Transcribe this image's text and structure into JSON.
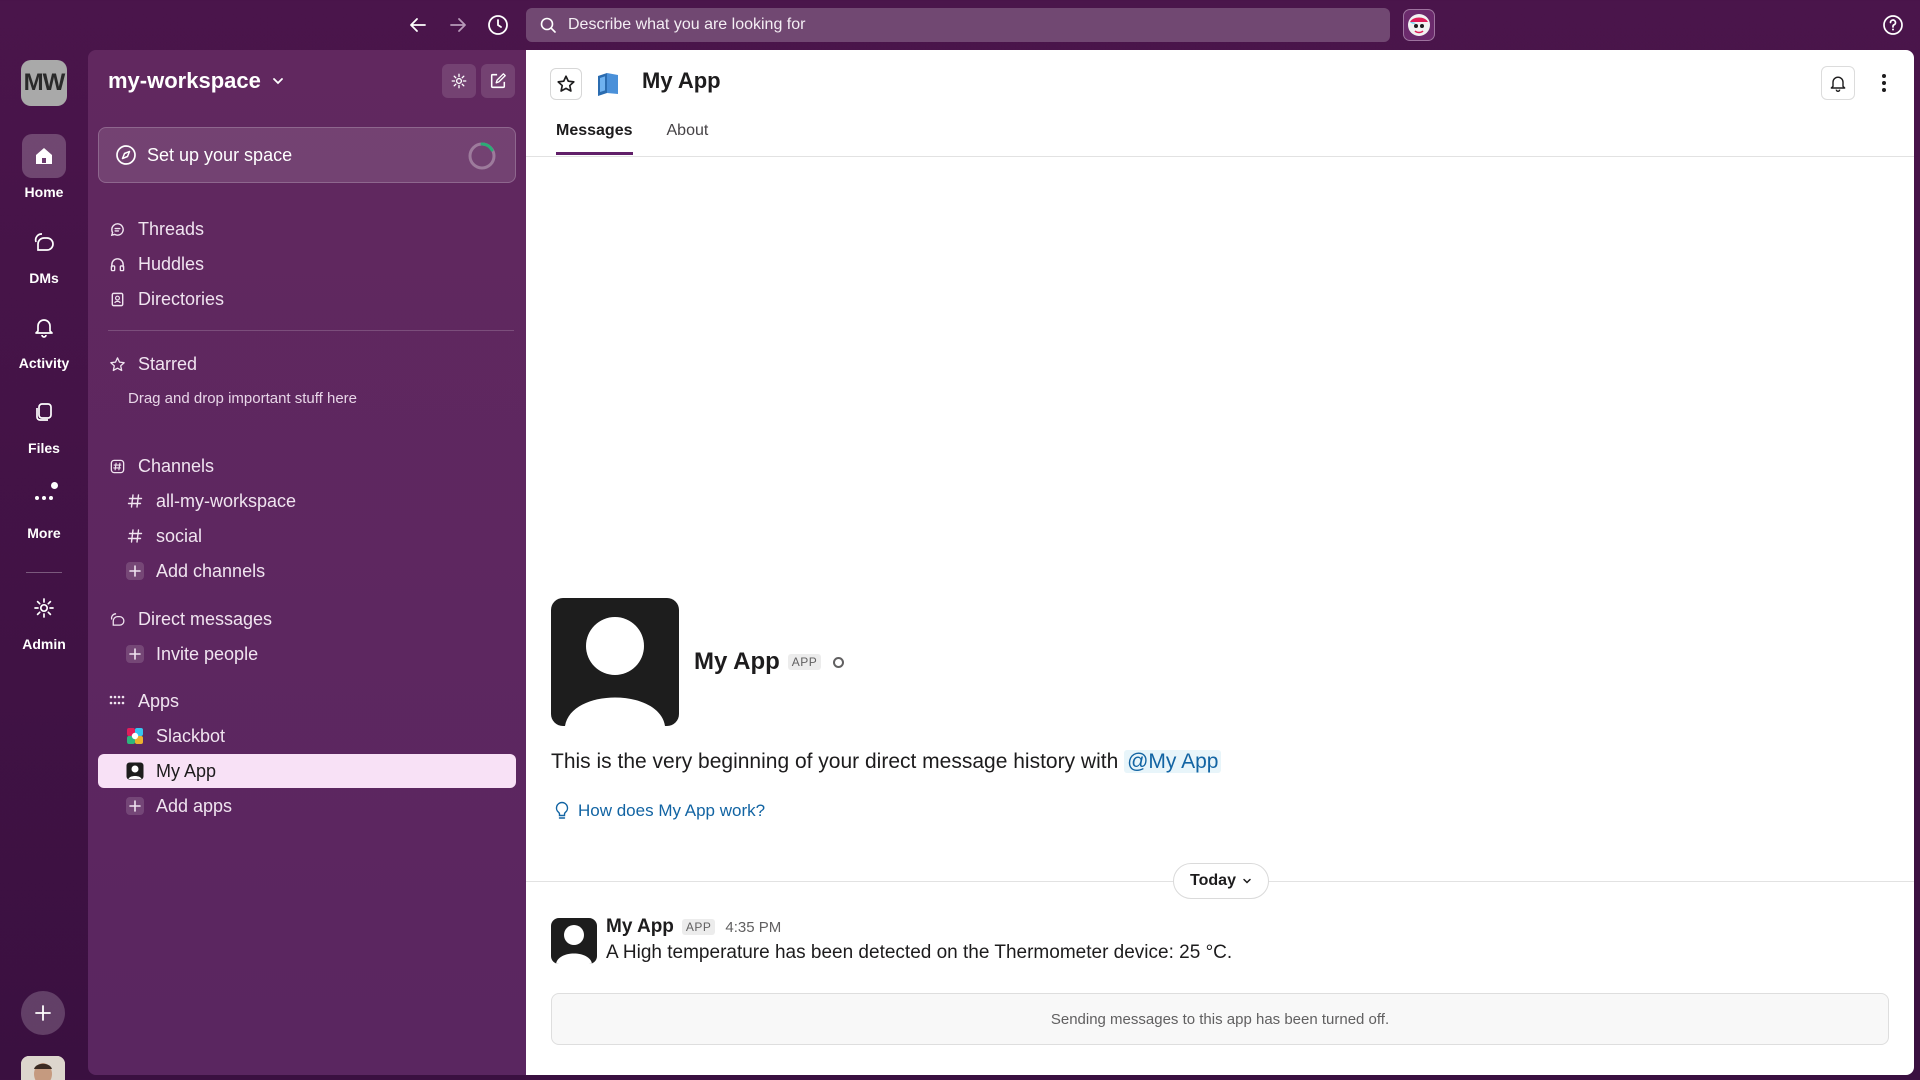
{
  "search": {
    "placeholder": "Describe what you are looking for"
  },
  "rail": {
    "workspace_initials": "MW",
    "items": [
      {
        "label": "Home"
      },
      {
        "label": "DMs"
      },
      {
        "label": "Activity"
      },
      {
        "label": "Files"
      },
      {
        "label": "More"
      },
      {
        "label": "Admin"
      }
    ]
  },
  "sidebar": {
    "workspace_name": "my-workspace",
    "setup_label": "Set up your space",
    "nav": [
      "Threads",
      "Huddles",
      "Directories"
    ],
    "starred": {
      "label": "Starred",
      "hint": "Drag and drop important stuff here"
    },
    "channels": {
      "label": "Channels",
      "items": [
        "all-my-workspace",
        "social"
      ],
      "add": "Add channels"
    },
    "dms": {
      "label": "Direct messages",
      "invite": "Invite people"
    },
    "apps": {
      "label": "Apps",
      "items": [
        "Slackbot",
        "My App"
      ],
      "add": "Add apps",
      "active": "My App"
    }
  },
  "main": {
    "title": "My App",
    "tabs": [
      {
        "label": "Messages",
        "active": true
      },
      {
        "label": "About",
        "active": false
      }
    ],
    "intro": {
      "name": "My App",
      "badge": "APP",
      "text": "This is the very beginning of your direct message history with",
      "mention": "@My App",
      "how_link": "How does My App work?"
    },
    "day_divider": "Today",
    "message": {
      "sender": "My App",
      "badge": "APP",
      "time": "4:35 PM",
      "text": "A High temperature has been detected on the Thermometer device: 25 °C."
    },
    "disabled_notice": "Sending messages to this app has been turned off."
  },
  "colors": {
    "aubergine": "#4a154b",
    "sidebar": "#5f2b62",
    "link": "#1264a3",
    "active_item": "#f8e1f6",
    "presence_online": "#2bac76"
  }
}
